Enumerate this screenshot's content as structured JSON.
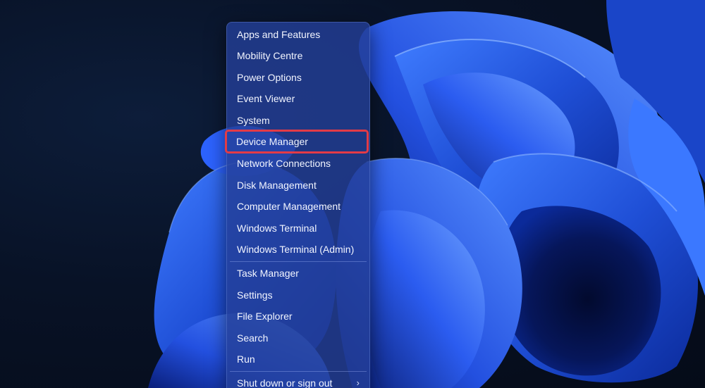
{
  "menu": {
    "group1": [
      {
        "label": "Apps and Features"
      },
      {
        "label": "Mobility Centre"
      },
      {
        "label": "Power Options"
      },
      {
        "label": "Event Viewer"
      },
      {
        "label": "System"
      },
      {
        "label": "Device Manager"
      },
      {
        "label": "Network Connections"
      },
      {
        "label": "Disk Management"
      },
      {
        "label": "Computer Management"
      },
      {
        "label": "Windows Terminal"
      },
      {
        "label": "Windows Terminal (Admin)"
      }
    ],
    "group2": [
      {
        "label": "Task Manager"
      },
      {
        "label": "Settings"
      },
      {
        "label": "File Explorer"
      },
      {
        "label": "Search"
      },
      {
        "label": "Run"
      }
    ],
    "group3": [
      {
        "label": "Shut down or sign out",
        "submenu_icon": "chevron-right-icon"
      }
    ],
    "highlighted_item": "Device Manager"
  },
  "colors": {
    "wallpaper_bloom": "#1f4fd6",
    "desktop_background": "#0a1428",
    "menu_background": "#233e96",
    "highlight_outline": "#e33b47",
    "menu_text": "#f2f5ff"
  }
}
